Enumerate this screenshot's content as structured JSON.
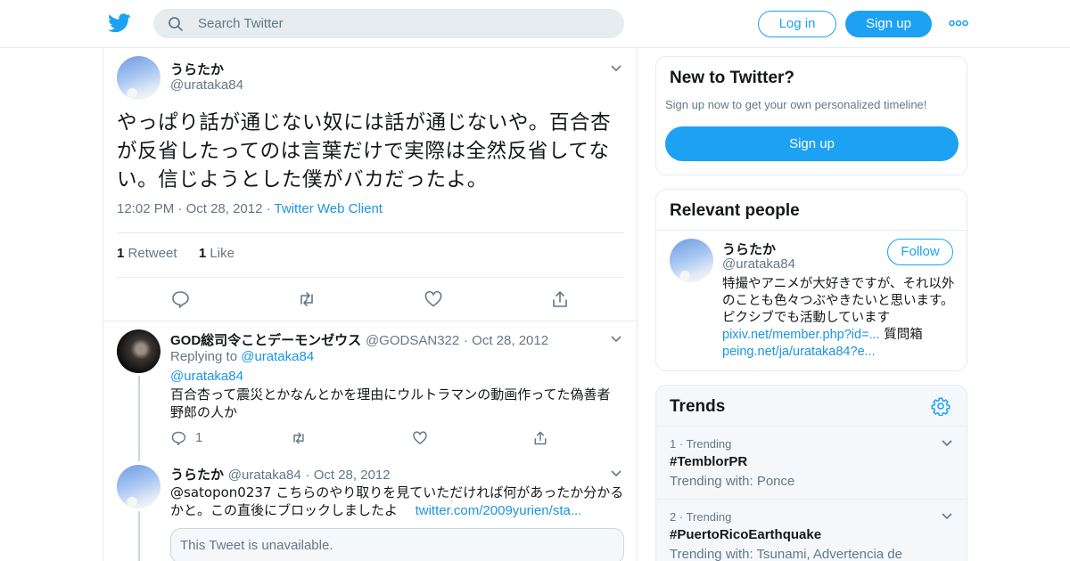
{
  "header": {
    "search_placeholder": "Search Twitter",
    "login_label": "Log in",
    "signup_label": "Sign up",
    "brand_color": "#1da1f2"
  },
  "main_tweet": {
    "author_name": "うらたか",
    "author_handle": "@urataka84",
    "text": "やっぱり話が通じない奴には話が通じないや。百合杏が反省したってのは言葉だけで実際は全然反省してない。信じようとした僕がバカだったよ。",
    "time": "12:02 PM",
    "date": "Oct 28, 2012",
    "source": "Twitter Web Client",
    "retweet_count": "1",
    "retweet_label": "Retweet",
    "like_count": "1",
    "like_label": "Like"
  },
  "replies": [
    {
      "author_name": "GOD総司令ことデーモンゼウス",
      "author_handle": "@GODSAN322",
      "date": "Oct 28, 2012",
      "replying_label": "Replying to",
      "replying_to": "@urataka84",
      "mention": "@urataka84",
      "text": "百合杏って震災とかなんとかを理由にウルトラマンの動画作ってた偽善者野郎の人か",
      "reply_count": "1"
    },
    {
      "author_name": "うらたか",
      "author_handle": "@urataka84",
      "date": "Oct 28, 2012",
      "text": "@satopon0237 こちらのやり取りを見ていただければ何があったか分かるかと。この直後にブロックしましたよ",
      "link": "twitter.com/2009yurien/sta...",
      "quoted_unavailable": "This Tweet is unavailable."
    }
  ],
  "sidebar": {
    "new_to_twitter": {
      "title": "New to Twitter?",
      "subtitle": "Sign up now to get your own personalized timeline!",
      "button": "Sign up"
    },
    "relevant_people": {
      "title": "Relevant people",
      "name": "うらたか",
      "handle": "@urataka84",
      "follow_label": "Follow",
      "bio_text": "特撮やアニメが大好きですが、それ以外のことも色々つぶやきたいと思います。ピクシブでも活動していま",
      "bio_text2": "す",
      "bio_link1": "pixiv.net/member.php?id=...",
      "bio_text3": "質問箱",
      "bio_link2": "peing.net/ja/urataka84?e..."
    },
    "trends": {
      "title": "Trends",
      "items": [
        {
          "rank": "1",
          "label": "Trending",
          "name": "#TemblorPR",
          "with": "Trending with: Ponce"
        },
        {
          "rank": "2",
          "label": "Trending",
          "name": "#PuertoRicoEarthquake",
          "with": "Trending with: Tsunami, Advertencia de"
        }
      ]
    }
  }
}
